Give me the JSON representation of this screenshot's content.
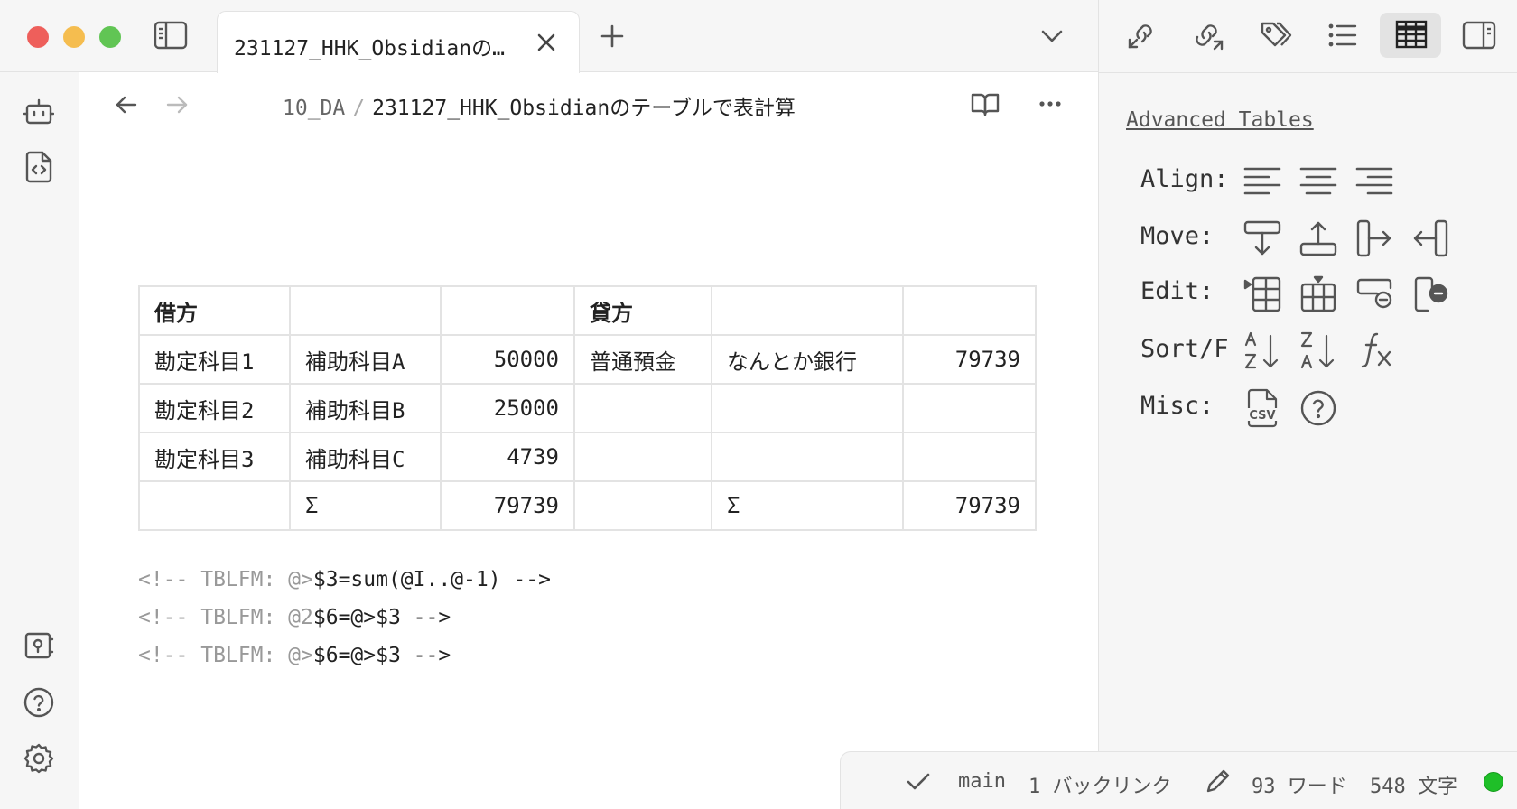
{
  "tab": {
    "title": "231127_HHK_Obsidianの…"
  },
  "breadcrumb": {
    "folder": "10_DA",
    "separator": "/",
    "file": "231127_HHK_Obsidianのテーブルで表計算"
  },
  "table": {
    "rows": [
      [
        "借方",
        "",
        "",
        "貸方",
        "",
        ""
      ],
      [
        "勘定科目1",
        "補助科目A",
        "50000",
        "普通預金",
        "なんとか銀行",
        "79739"
      ],
      [
        "勘定科目2",
        "補助科目B",
        "25000",
        "",
        "",
        ""
      ],
      [
        "勘定科目3",
        "補助科目C",
        "4739",
        "",
        "",
        ""
      ],
      [
        "",
        "Σ",
        "79739",
        "",
        "Σ",
        "79739"
      ]
    ]
  },
  "formulas": [
    {
      "prefix": "<!-- TBLFM: @>",
      "rest": "$3=sum(@I..@-1) -->"
    },
    {
      "prefix": "<!-- TBLFM: @2",
      "rest": "$6=@>$3 -->"
    },
    {
      "prefix": "<!-- TBLFM: @>",
      "rest": "$6=@>$3 -->"
    }
  ],
  "sidebar": {
    "title": "Advanced Tables",
    "align_label": "Align:",
    "move_label": "Move:",
    "edit_label": "Edit:",
    "sort_label": "Sort/F",
    "misc_label": "Misc:"
  },
  "statusbar": {
    "branch": "main",
    "backlinks": "1 バックリンク",
    "words": "93 ワード",
    "chars": "548 文字"
  },
  "icons": {
    "ribbon": [
      "bot-icon",
      "file-code-icon",
      "vault-icon",
      "help-icon",
      "settings-icon"
    ],
    "toolbar": [
      "backlinks-in-icon",
      "links-out-icon",
      "tags-icon",
      "outline-icon",
      "table-icon",
      "right-sidebar-icon"
    ]
  },
  "colors": {
    "accent_green": "#1fbf28",
    "traffic_red": "#ee5f5b",
    "traffic_yellow": "#f5bd4f",
    "traffic_green": "#61c554"
  }
}
